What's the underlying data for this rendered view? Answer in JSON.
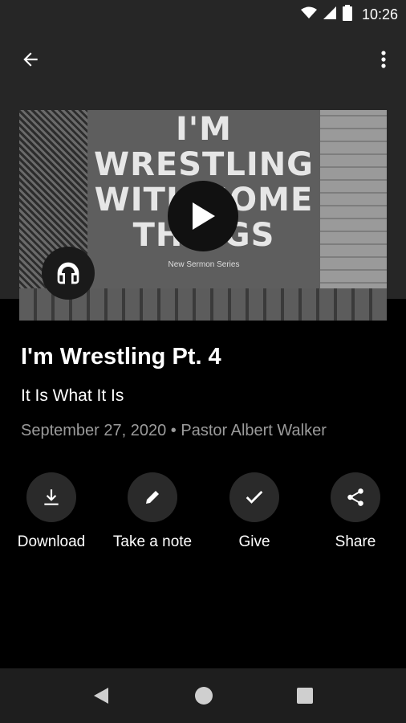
{
  "status_bar": {
    "time": "10:26",
    "icons": [
      "wifi-icon",
      "cellular-signal-icon",
      "battery-icon"
    ]
  },
  "app_bar": {
    "back_icon": "arrow-back-icon",
    "menu_icon": "more-vert-icon"
  },
  "artwork": {
    "title_lines": [
      "I'M",
      "WRESTLING",
      "WITH SOME",
      "THINGS"
    ],
    "subtitle": "New Sermon Series",
    "play_icon": "play-icon",
    "audio_icon": "headphones-icon"
  },
  "sermon": {
    "title": "I'm Wrestling Pt. 4",
    "subtitle": "It Is What It Is",
    "meta": "September 27, 2020 • Pastor Albert Walker"
  },
  "actions": [
    {
      "label": "Download",
      "icon": "download-icon"
    },
    {
      "label": "Take a note",
      "icon": "pencil-icon"
    },
    {
      "label": "Give",
      "icon": "check-icon"
    },
    {
      "label": "Share",
      "icon": "share-icon"
    }
  ],
  "nav_bar": {
    "icons": [
      "nav-back-icon",
      "nav-home-icon",
      "nav-recents-icon"
    ]
  },
  "colors": {
    "background": "#000000",
    "app_bar": "#262626",
    "secondary_text": "#9b9b9b",
    "action_circle": "#2a2a2a"
  }
}
